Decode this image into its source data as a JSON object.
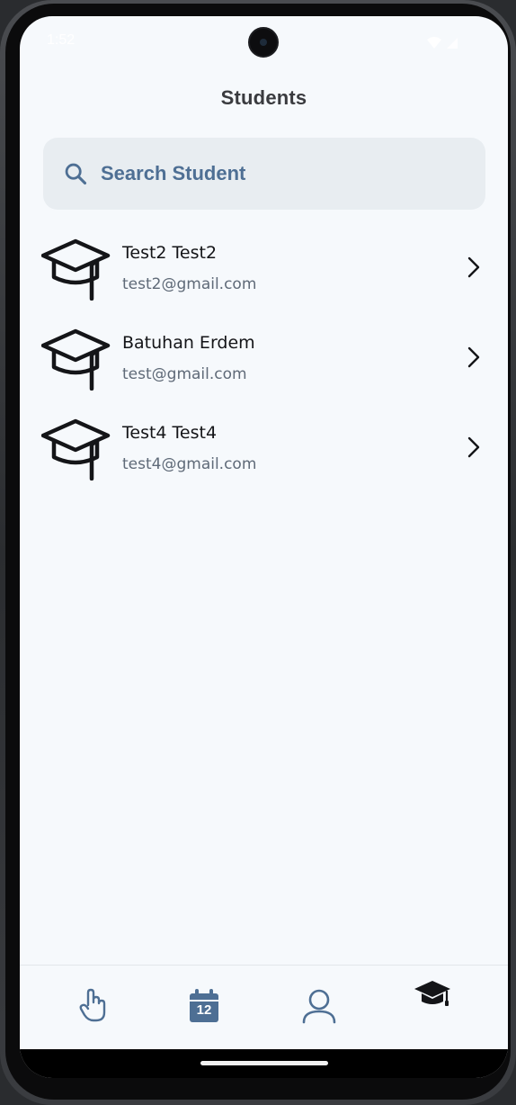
{
  "status_bar": {
    "time": "1:52"
  },
  "header": {
    "title": "Students"
  },
  "search": {
    "placeholder": "Search Student",
    "value": ""
  },
  "students": [
    {
      "name": "Test2 Test2",
      "email": "test2@gmail.com"
    },
    {
      "name": "Batuhan Erdem",
      "email": "test@gmail.com"
    },
    {
      "name": "Test4 Test4",
      "email": "test4@gmail.com"
    }
  ],
  "bottom_nav": {
    "items": [
      {
        "icon": "pointer-hand-icon",
        "active": false
      },
      {
        "icon": "calendar-icon",
        "label": "12",
        "active": false
      },
      {
        "icon": "user-icon",
        "active": false
      },
      {
        "icon": "graduation-cap-icon",
        "active": true
      }
    ]
  },
  "colors": {
    "background": "#f6f9fc",
    "search_bg": "#e8edf1",
    "accent": "#4e6f94",
    "active_icon": "#141518"
  }
}
